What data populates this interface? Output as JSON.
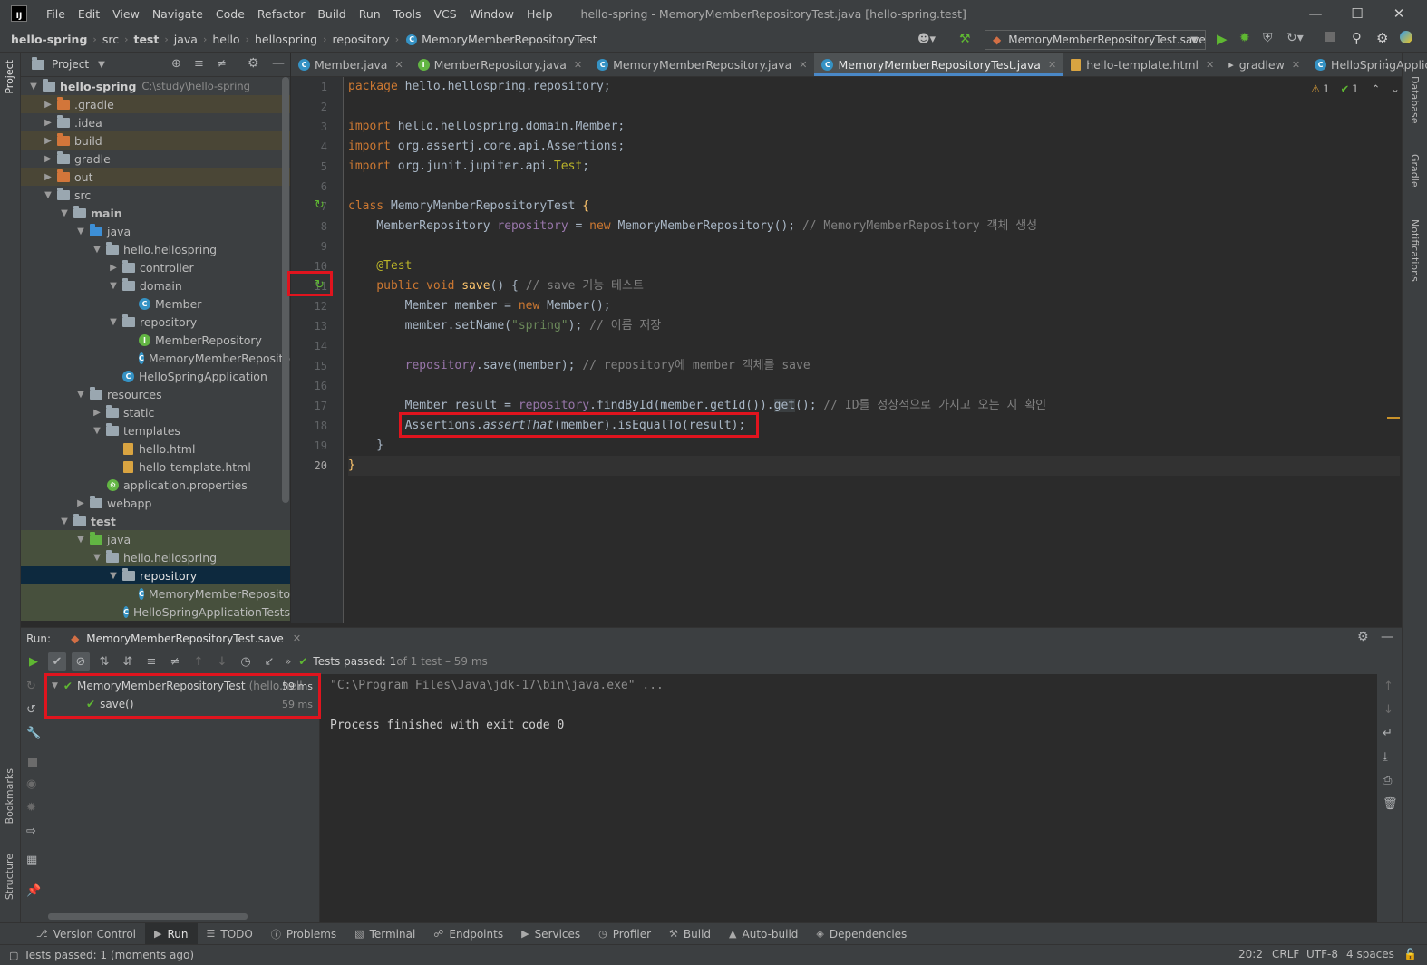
{
  "menu": {
    "logo": "IJ",
    "items": [
      "File",
      "Edit",
      "View",
      "Navigate",
      "Code",
      "Refactor",
      "Build",
      "Run",
      "Tools",
      "VCS",
      "Window",
      "Help"
    ],
    "window_title": "hello-spring - MemoryMemberRepositoryTest.java [hello-spring.test]"
  },
  "breadcrumbs": [
    "hello-spring",
    "src",
    "test",
    "java",
    "hello",
    "hellospring",
    "repository",
    "MemoryMemberRepositoryTest"
  ],
  "run_config": "MemoryMemberRepositoryTest.save",
  "project_panel": {
    "title": "Project",
    "tree": [
      {
        "label": "hello-spring",
        "path": "C:\\study\\hello-spring"
      },
      {
        "label": ".gradle"
      },
      {
        "label": ".idea"
      },
      {
        "label": "build"
      },
      {
        "label": "gradle"
      },
      {
        "label": "out"
      },
      {
        "label": "src"
      },
      {
        "label": "main"
      },
      {
        "label": "java"
      },
      {
        "label": "hello.hellospring"
      },
      {
        "label": "controller"
      },
      {
        "label": "domain"
      },
      {
        "label": "Member"
      },
      {
        "label": "repository"
      },
      {
        "label": "MemberRepository"
      },
      {
        "label": "MemoryMemberRepository"
      },
      {
        "label": "HelloSpringApplication"
      },
      {
        "label": "resources"
      },
      {
        "label": "static"
      },
      {
        "label": "templates"
      },
      {
        "label": "hello.html"
      },
      {
        "label": "hello-template.html"
      },
      {
        "label": "application.properties"
      },
      {
        "label": "webapp"
      },
      {
        "label": "test"
      },
      {
        "label": "java"
      },
      {
        "label": "hello.hellospring"
      },
      {
        "label": "repository"
      },
      {
        "label": "MemoryMemberRepository"
      },
      {
        "label": "HelloSpringApplicationTests"
      }
    ]
  },
  "tabs": [
    {
      "label": "Member.java"
    },
    {
      "label": "MemberRepository.java"
    },
    {
      "label": "MemoryMemberRepository.java"
    },
    {
      "label": "MemoryMemberRepositoryTest.java"
    },
    {
      "label": "hello-template.html"
    },
    {
      "label": "gradlew"
    },
    {
      "label": "HelloSpringApplication.jav"
    }
  ],
  "inspection": {
    "warnings": "1",
    "ok": "1"
  },
  "line_numbers": [
    "1",
    "2",
    "3",
    "4",
    "5",
    "6",
    "7",
    "8",
    "9",
    "10",
    "11",
    "12",
    "13",
    "14",
    "15",
    "16",
    "17",
    "18",
    "19",
    "20"
  ],
  "code": {
    "l1": [
      "package",
      " hello.hellospring.repository;"
    ],
    "l3": [
      "import",
      " hello.hellospring.domain.Member;"
    ],
    "l4": [
      "import",
      " org.assertj.core.api.Assertions;"
    ],
    "l5": [
      "import",
      " org.junit.jupiter.api.",
      "Test",
      ";"
    ],
    "l7": [
      "class",
      " MemoryMemberRepositoryTest ",
      "{"
    ],
    "l8": [
      "    MemberRepository ",
      "repository",
      " = ",
      "new",
      " MemoryMemberRepository(); ",
      "// MemoryMemberRepository 객체 생성"
    ],
    "l10": [
      "    @Test"
    ],
    "l11": [
      "    public void",
      " ",
      "save",
      "() { ",
      "// save 기능 테스트"
    ],
    "l12": [
      "        Member member = ",
      "new",
      " Member();"
    ],
    "l13": [
      "        member.setName(",
      "\"spring\"",
      "); ",
      "// 이름 저장"
    ],
    "l15": [
      "        ",
      "repository",
      ".save(member); ",
      "// repository에 member 객체를 save"
    ],
    "l17": [
      "        Member result = ",
      "repository",
      ".findById(member.getId()).",
      "get",
      "(); ",
      "// ID를 정상적으로 가지고 오는 지 확인"
    ],
    "l18": [
      "        Assertions.",
      "assertThat",
      "(member).isEqualTo(result);"
    ],
    "l19": [
      "    }"
    ],
    "l20": [
      "}"
    ]
  },
  "run_panel": {
    "label": "Run:",
    "tab": "MemoryMemberRepositoryTest.save",
    "status_prefix": "Tests passed: ",
    "status_count": "1",
    "status_suffix": " of 1 test – 59 ms",
    "tests": [
      {
        "name": "MemoryMemberRepositoryTest",
        "detail": "(hello.hell",
        "time": "59 ms"
      },
      {
        "name": "save()",
        "time": "59 ms"
      }
    ],
    "console": [
      "\"C:\\Program Files\\Java\\jdk-17\\bin\\java.exe\" ...",
      "Process finished with exit code 0"
    ]
  },
  "side_tabs": {
    "left": [
      "Project",
      "Bookmarks",
      "Structure"
    ],
    "right": [
      "Database",
      "Gradle",
      "Notifications"
    ]
  },
  "bottom_tabs": [
    "Version Control",
    "Run",
    "TODO",
    "Problems",
    "Terminal",
    "Endpoints",
    "Services",
    "Profiler",
    "Build",
    "Auto-build",
    "Dependencies"
  ],
  "status_bar": {
    "message": "Tests passed: 1 (moments ago)",
    "position": "20:2",
    "line_sep": "CRLF",
    "encoding": "UTF-8",
    "indent": "4 spaces"
  },
  "colors": {
    "accent": "#4a88c7",
    "highlight": "#e0141e",
    "pass": "#5fb832"
  }
}
